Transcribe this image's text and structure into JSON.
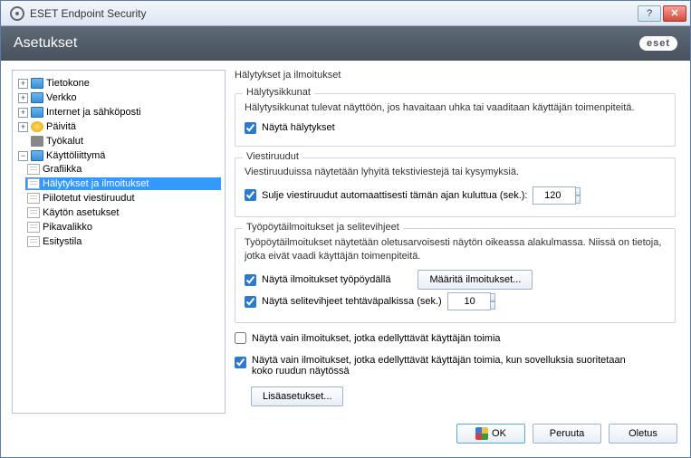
{
  "titlebar": {
    "app_name": "ESET Endpoint Security"
  },
  "header": {
    "title": "Asetukset",
    "brand": "eset"
  },
  "tree": {
    "nodes": [
      {
        "label": "Tietokone",
        "expandable": true,
        "icon": "monitor"
      },
      {
        "label": "Verkko",
        "expandable": true,
        "icon": "monitor"
      },
      {
        "label": "Internet ja sähköposti",
        "expandable": true,
        "icon": "monitor"
      },
      {
        "label": "Päivitä",
        "expandable": true,
        "icon": "refresh"
      },
      {
        "label": "Työkalut",
        "expandable": true,
        "icon": "tools"
      },
      {
        "label": "Käyttöliittymä",
        "expandable": true,
        "expanded": true,
        "icon": "monitor",
        "children": [
          {
            "label": "Grafiikka"
          },
          {
            "label": "Hälytykset ja ilmoitukset",
            "selected": true
          },
          {
            "label": "Piilotetut viestiruudut"
          },
          {
            "label": "Käytön asetukset"
          },
          {
            "label": "Pikavalikko"
          },
          {
            "label": "Esitystila"
          }
        ]
      }
    ]
  },
  "content": {
    "page_title": "Hälytykset ja ilmoitukset",
    "g1": {
      "title": "Hälytysikkunat",
      "desc": "Hälytysikkunat tulevat näyttöön, jos havaitaan uhka tai vaaditaan käyttäjän toimenpiteitä.",
      "cb1_label": "Näytä hälytykset",
      "cb1_checked": true
    },
    "g2": {
      "title": "Viestiruudut",
      "desc": "Viestiruuduissa näytetään lyhyitä tekstiviestejä tai kysymyksiä.",
      "cb1_label": "Sulje viestiruudut automaattisesti tämän ajan kuluttua (sek.):",
      "cb1_checked": true,
      "timeout_value": "120"
    },
    "g3": {
      "title": "Työpöytäilmoitukset ja selitevihjeet",
      "desc": "Työpöytäilmoitukset näytetään oletusarvoisesti näytön oikeassa alakulmassa. Niissä on tietoja, jotka eivät vaadi käyttäjän toimenpiteitä.",
      "cb1_label": "Näytä ilmoitukset työpöydällä",
      "cb1_checked": true,
      "btn_config": "Määritä ilmoitukset...",
      "cb2_label": "Näytä selitevihjeet tehtäväpalkissa (sek.)",
      "cb2_checked": true,
      "tip_seconds": "10"
    },
    "cb_only1_label": "Näytä vain ilmoitukset, jotka edellyttävät käyttäjän toimia",
    "cb_only1_checked": false,
    "cb_only2_label": "Näytä vain ilmoitukset, jotka edellyttävät käyttäjän toimia, kun sovelluksia suoritetaan koko ruudun näytössä",
    "cb_only2_checked": true,
    "btn_more": "Lisäasetukset..."
  },
  "footer": {
    "ok": "OK",
    "cancel": "Peruuta",
    "default": "Oletus"
  }
}
